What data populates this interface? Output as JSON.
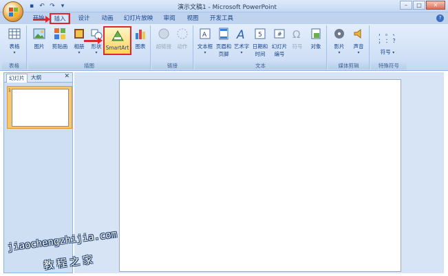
{
  "title": "演示文稿1 - Microsoft PowerPoint",
  "tabs": [
    "开始",
    "插入",
    "设计",
    "动画",
    "幻灯片放映",
    "审阅",
    "视图",
    "开发工具"
  ],
  "active_tab": "插入",
  "help_label": "?",
  "window_controls": {
    "minimize": "–",
    "maximize": "□",
    "close": "✕"
  },
  "ribbon": {
    "groups": {
      "tables": {
        "label": "表格",
        "commands": {
          "table": "表格"
        }
      },
      "illustrations": {
        "label": "插图",
        "commands": {
          "picture": "图片",
          "clipart": "剪贴画",
          "album": "相册",
          "shapes": "形状",
          "smartart": "SmartArt",
          "chart": "图表"
        }
      },
      "links": {
        "label": "链接",
        "commands": {
          "hyperlink": "超链接",
          "action": "动作"
        }
      },
      "text": {
        "label": "文本",
        "commands": {
          "textbox": "文本框",
          "header_footer_1": "页眉和",
          "header_footer_2": "页脚",
          "wordart": "艺术字",
          "datetime_1": "日期和",
          "datetime_2": "时间",
          "slidenum_1": "幻灯片",
          "slidenum_2": "编号",
          "symbol": "符号",
          "object": "对象"
        }
      },
      "media": {
        "label": "媒体剪辑",
        "commands": {
          "movie": "影片",
          "sound": "声音"
        }
      },
      "special": {
        "label": "特殊符号",
        "commands": {
          "symbol": "符号"
        }
      }
    }
  },
  "panel": {
    "tabs": [
      "幻灯片",
      "大纲"
    ],
    "close": "✕",
    "slide_number": "1"
  },
  "watermark": {
    "line1": "jiaochengzhijia.com",
    "line2": "教程之家"
  },
  "colors": {
    "highlight": "#e0262c",
    "ribbon": "#d0e0f6"
  }
}
